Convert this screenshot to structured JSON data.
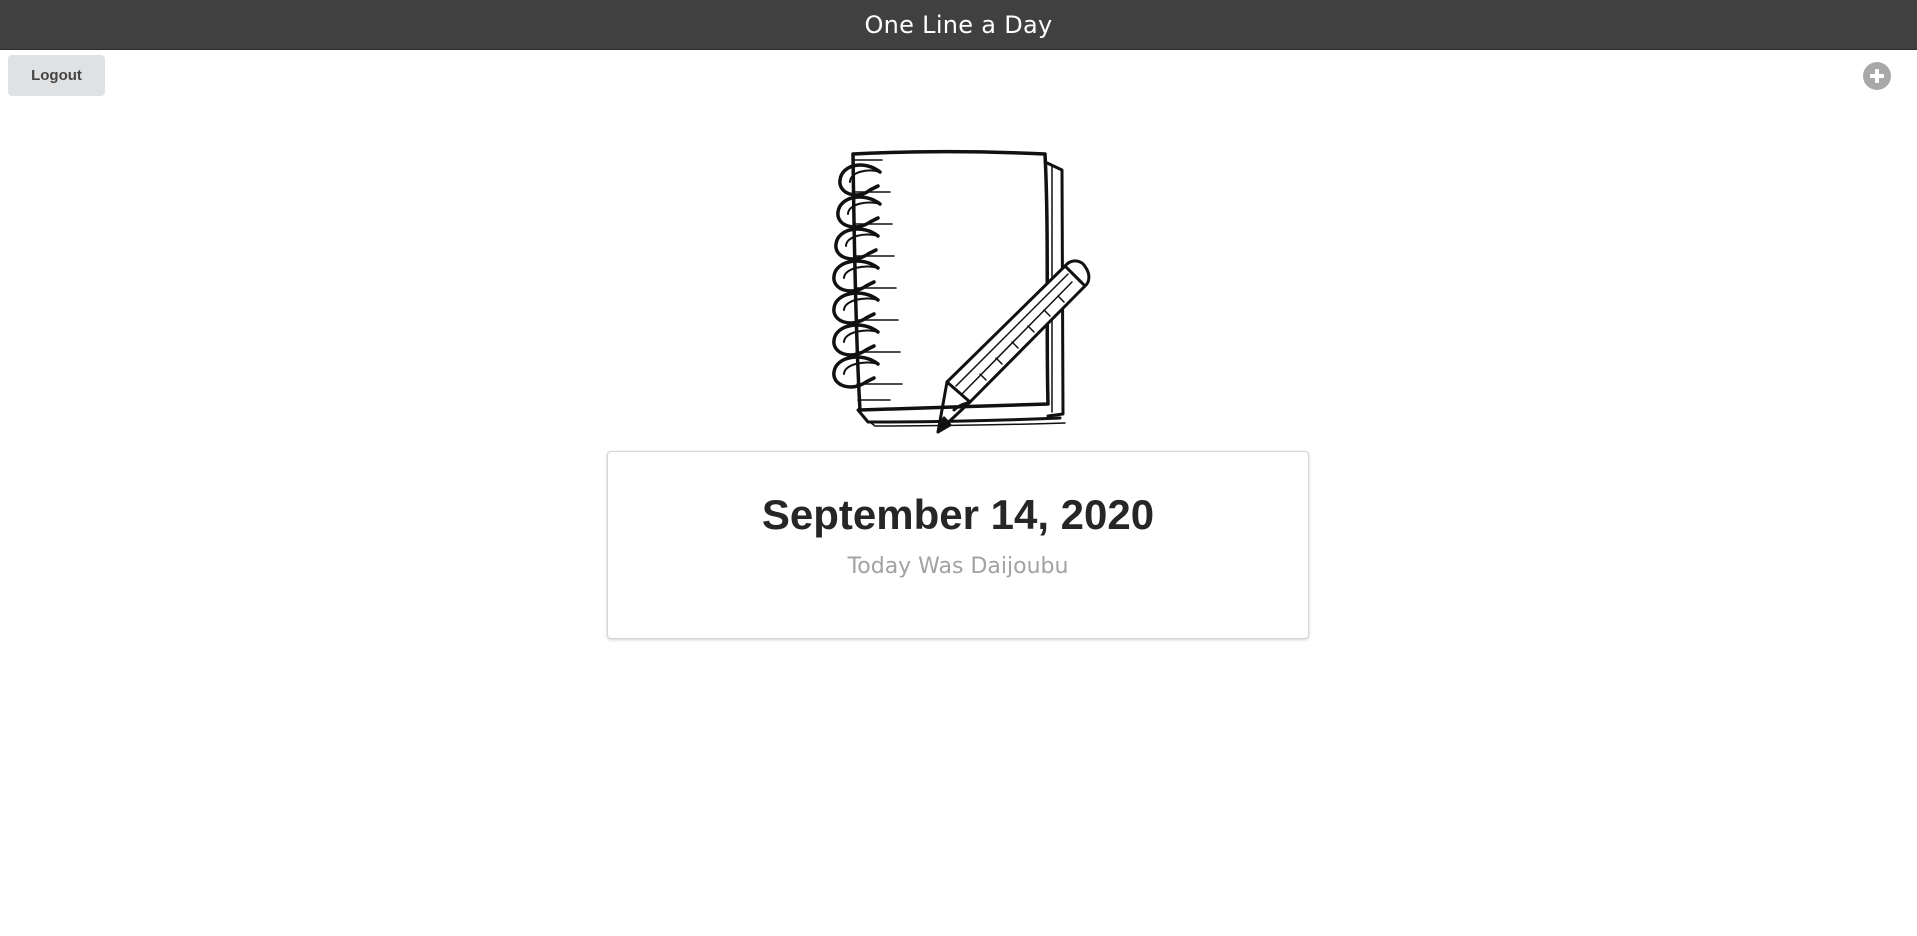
{
  "header": {
    "title": "One Line a Day"
  },
  "toolbar": {
    "logout_label": "Logout",
    "add_icon": "plus-circle-icon"
  },
  "hero": {
    "illustration": "notebook-pencil-illustration"
  },
  "entries": [
    {
      "date": "September 14, 2020",
      "text": "Today Was Daijoubu"
    }
  ],
  "colors": {
    "header_bg": "#404040",
    "header_text": "#ffffff",
    "button_bg": "#e0e1e2",
    "add_icon": "#a8a8a8",
    "date_text": "#262626",
    "entry_text": "#a2a2a2"
  }
}
